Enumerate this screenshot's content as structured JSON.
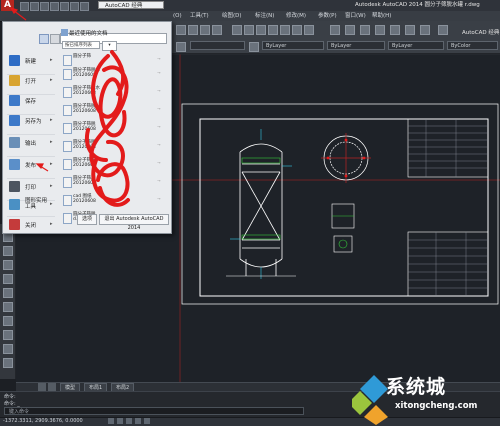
{
  "window": {
    "title": "Autodesk AutoCAD 2014",
    "file_title": "圆分子筛脱水罐 r.dwg",
    "logo": "A",
    "workspace_select": "AutoCAD 经典",
    "workspace_label": "AutoCAD 经典"
  },
  "menu_bar": [
    "修改(M)",
    "参数(P)",
    "窗口(W)",
    "帮助(H)"
  ],
  "menu_bar_partial": [
    "(O)",
    "工具(T)",
    "绘图(D)",
    "标注(N)"
  ],
  "property_combos": [
    "ByLayer",
    "ByLayer",
    "ByLayer",
    "ByColor"
  ],
  "app_menu": {
    "search_placeholder": "",
    "recent_header": "最近使用的文档",
    "sort_label": "按已排序列表",
    "view_label": "",
    "left_items": [
      {
        "label": "新建",
        "color": "#2e6cc5"
      },
      {
        "label": "打开",
        "color": "#d8a431"
      },
      {
        "label": "保存",
        "color": "#3c79c9"
      },
      {
        "label": "另存为",
        "color": "#3c79c9"
      },
      {
        "label": "输出",
        "color": "#6a8fb7"
      },
      {
        "label": "发布",
        "color": "#5b8fc9"
      },
      {
        "label": "打印",
        "color": "#4d5560"
      },
      {
        "label": "图形实用工具",
        "color": "#4a90c4"
      },
      {
        "label": "关闭",
        "color": "#c43b3b"
      }
    ],
    "recent_files": [
      {
        "name": "圆分子筛",
        "sub": ""
      },
      {
        "name": "圆分子筛脱水",
        "sub": "20120608"
      },
      {
        "name": "圆分子筛脱水",
        "sub": "20120608"
      },
      {
        "name": "圆分子筛脱",
        "sub": "20120608"
      },
      {
        "name": "圆分子筛脱",
        "sub": "20120608"
      },
      {
        "name": "圆分子筛脱",
        "sub": "20120608"
      },
      {
        "name": "圆分子筛脱",
        "sub": "20120608"
      },
      {
        "name": "圆分子筛脱",
        "sub": "20120608"
      },
      {
        "name": "cad 图纸",
        "sub": "20120608"
      },
      {
        "name": "圆分子筛脱",
        "sub": "d.dwg"
      }
    ],
    "options_button": "选项",
    "exit_button": "退出 Autodesk AutoCAD 2014"
  },
  "layout_tabs": [
    "模型",
    "布局1",
    "布局2"
  ],
  "command": {
    "line1": "命令:",
    "line2": "命令: _",
    "prompt": "键入命令"
  },
  "status": {
    "coordinates": "-1372.3311, 2909.3676, 0.0000"
  },
  "watermark": {
    "text": "系统城",
    "url": "xitongcheng.com"
  },
  "colors": {
    "accent": "#b3261e",
    "annotation_red": "#e31b1b",
    "drawing_bg": "#1e2228",
    "cad_lines": "#ffffff",
    "cad_green": "#36c93a",
    "cad_cyan": "#32c8e6"
  }
}
